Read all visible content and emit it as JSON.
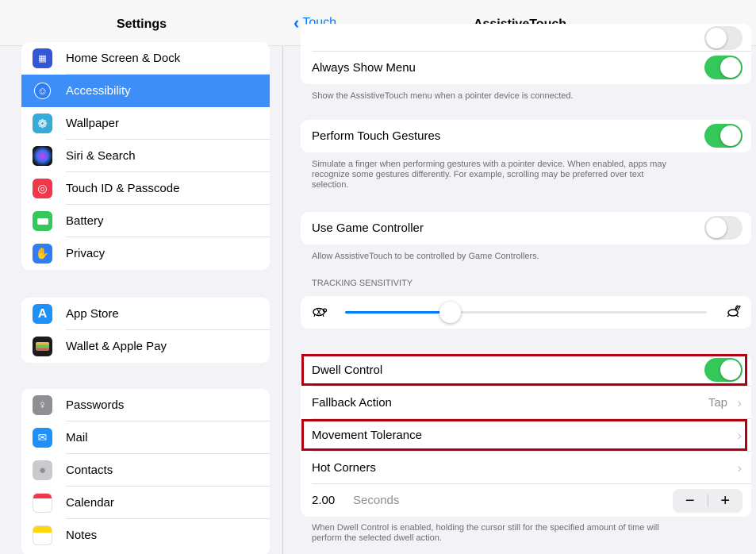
{
  "sidebar": {
    "title": "Settings",
    "group1": [
      {
        "label": "Home Screen & Dock",
        "icon": "home-screen-icon",
        "color": "#3557d6"
      },
      {
        "label": "Accessibility",
        "icon": "accessibility-icon",
        "color": "#2e7cf6",
        "selected": true
      },
      {
        "label": "Wallpaper",
        "icon": "wallpaper-icon",
        "color": "#37aadc"
      },
      {
        "label": "Siri & Search",
        "icon": "siri-icon",
        "color": "#222222"
      },
      {
        "label": "Touch ID & Passcode",
        "icon": "fingerprint-icon",
        "color": "#f2364b"
      },
      {
        "label": "Battery",
        "icon": "battery-icon",
        "color": "#34c759"
      },
      {
        "label": "Privacy",
        "icon": "privacy-hand-icon",
        "color": "#2e7cf6"
      }
    ],
    "group2": [
      {
        "label": "App Store",
        "icon": "app-store-icon",
        "color": "#1e90f8"
      },
      {
        "label": "Wallet & Apple Pay",
        "icon": "wallet-icon",
        "color": "#1c1c1e"
      }
    ],
    "group3": [
      {
        "label": "Passwords",
        "icon": "key-icon",
        "color": "#8e8e93"
      },
      {
        "label": "Mail",
        "icon": "mail-icon",
        "color": "#1e90f8"
      },
      {
        "label": "Contacts",
        "icon": "contacts-icon",
        "color": "#b8b8bd"
      },
      {
        "label": "Calendar",
        "icon": "calendar-icon",
        "color": "#ffffff"
      },
      {
        "label": "Notes",
        "icon": "notes-icon",
        "color": "#ffd60a"
      }
    ]
  },
  "nav": {
    "back_label": "Touch",
    "title": "AssistiveTouch"
  },
  "main": {
    "always_show_menu": {
      "label": "Always Show Menu",
      "on": true,
      "footer": "Show the AssistiveTouch menu when a pointer device is connected."
    },
    "perform_touch_gestures": {
      "label": "Perform Touch Gestures",
      "on": true,
      "footer_line1": "Simulate a finger when performing gestures with a pointer device. When enabled, apps may",
      "footer_line2": "recognize some gestures differently. For example, scrolling may be preferred over text",
      "footer_line3": "selection."
    },
    "use_game_controller": {
      "label": "Use Game Controller",
      "on": false,
      "footer": "Allow AssistiveTouch to be controlled by Game Controllers."
    },
    "tracking_sensitivity": {
      "header": "TRACKING SENSITIVITY",
      "value": 0.29,
      "slow_icon": "turtle-icon",
      "fast_icon": "hare-icon"
    },
    "dwell_control": {
      "label": "Dwell Control",
      "on": true
    },
    "fallback_action": {
      "label": "Fallback Action",
      "value": "Tap"
    },
    "movement_tolerance": {
      "label": "Movement Tolerance"
    },
    "hot_corners": {
      "label": "Hot Corners"
    },
    "dwell_time": {
      "value": "2.00",
      "unit": "Seconds",
      "minus": "−",
      "plus": "+"
    },
    "dwell_footer_line1": "When Dwell Control is enabled, holding the cursor still for the specified amount of time will",
    "dwell_footer_line2": "perform the selected dwell action."
  },
  "colors": {
    "accent": "#007aff",
    "toggle_on": "#34c759",
    "highlight": "#b00010",
    "selected": "#3e8ef7"
  }
}
